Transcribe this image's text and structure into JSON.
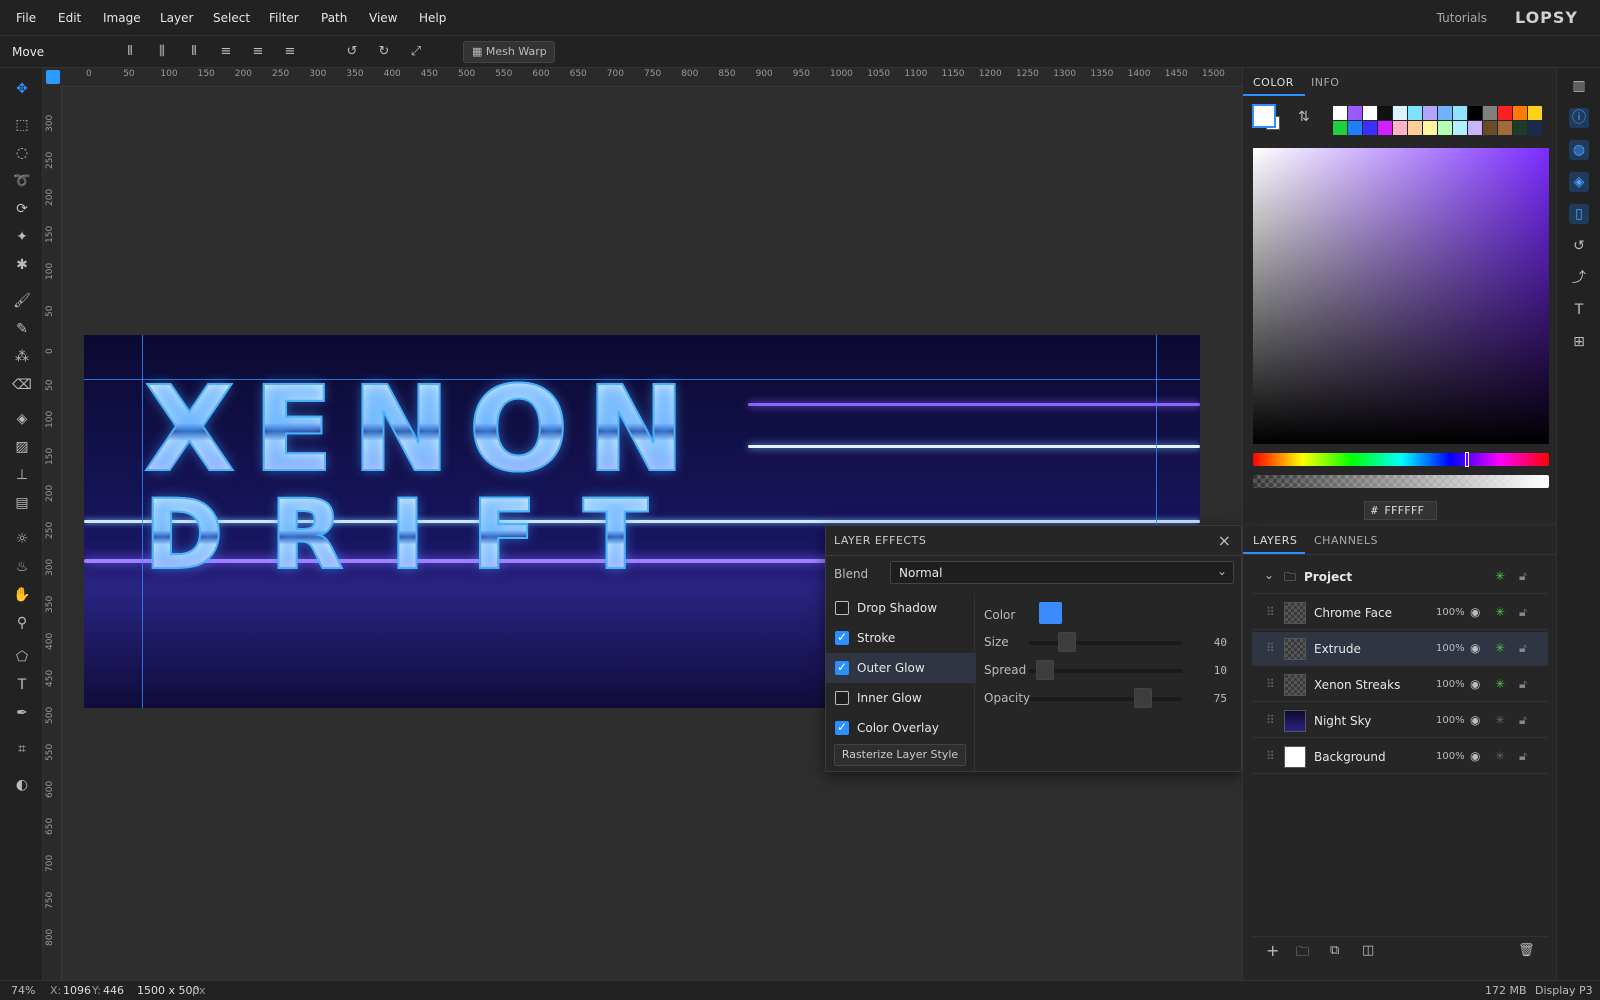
{
  "app": {
    "logo": "LOPSY",
    "tutorials": "Tutorials"
  },
  "menu": [
    "File",
    "Edit",
    "Image",
    "Layer",
    "Select",
    "Filter",
    "Path",
    "View",
    "Help"
  ],
  "options_bar": {
    "tool_name": "Move",
    "mesh_warp": "Mesh Warp"
  },
  "ruler_top": [
    "0",
    "50",
    "100",
    "150",
    "200",
    "250",
    "300",
    "350",
    "400",
    "450",
    "500",
    "550",
    "600",
    "650",
    "700",
    "750",
    "800",
    "850",
    "900",
    "950",
    "1000",
    "1050",
    "1100",
    "1150",
    "1200",
    "1250",
    "1300",
    "1350",
    "1400",
    "1450",
    "1500"
  ],
  "ruler_left": [
    "300",
    "250",
    "200",
    "150",
    "100",
    "50",
    "0",
    "50",
    "100",
    "150",
    "200",
    "250",
    "300",
    "350",
    "400",
    "450",
    "500",
    "550",
    "600",
    "650",
    "700",
    "750",
    "800"
  ],
  "canvas": {
    "line1": "XENON",
    "line2": "DRIFT"
  },
  "color_panel": {
    "tabs": [
      "COLOR",
      "INFO"
    ],
    "hex": "FFFFFF",
    "swatches": [
      "#ffffff",
      "#9b59ff",
      "#ffffff",
      "#111111",
      "#d9f2ff",
      "#7fe0ff",
      "#b2a4ff",
      "#6fb3ff",
      "#8fe3ff",
      "#000000",
      "#808080",
      "#ff2020",
      "#ff7a00",
      "#ffd21a",
      "#1fd13a",
      "#1f7fff",
      "#3a2fff",
      "#d11fff",
      "#ffb3c6",
      "#ffcf99",
      "#fff59e",
      "#b3ffb3",
      "#b3f0ff",
      "#c9b3ff",
      "#6b4a2a",
      "#a06a3a",
      "#1a3d2a",
      "#1a2a4a"
    ]
  },
  "layers_panel": {
    "tabs": [
      "LAYERS",
      "CHANNELS"
    ],
    "group": "Project",
    "layers": [
      {
        "name": "Chrome Face",
        "opacity": "100%"
      },
      {
        "name": "Extrude",
        "opacity": "100%"
      },
      {
        "name": "Xenon Streaks",
        "opacity": "100%"
      },
      {
        "name": "Night Sky",
        "opacity": "100%"
      },
      {
        "name": "Background",
        "opacity": "100%"
      }
    ]
  },
  "layer_effects": {
    "title": "LAYER EFFECTS",
    "blend_label": "Blend",
    "blend_value": "Normal",
    "effects": [
      {
        "label": "Drop Shadow",
        "checked": false
      },
      {
        "label": "Stroke",
        "checked": true
      },
      {
        "label": "Outer Glow",
        "checked": true
      },
      {
        "label": "Inner Glow",
        "checked": false
      },
      {
        "label": "Color Overlay",
        "checked": true
      }
    ],
    "rasterize": "Rasterize Layer Style",
    "color_label": "Color",
    "color_value": "#3b8bff",
    "size": {
      "label": "Size",
      "value": "40",
      "fraction": 0.2
    },
    "spread": {
      "label": "Spread",
      "value": "10",
      "fraction": 0.05
    },
    "opacity": {
      "label": "Opacity",
      "value": "75",
      "fraction": 0.72
    }
  },
  "status": {
    "zoom": "74%",
    "x_label": "X:",
    "x": "1096",
    "y_label": "Y:",
    "y": "446",
    "doc_size": "1500 x 500",
    "unit": "px",
    "memory": "172 MB",
    "profile": "Display P3"
  }
}
